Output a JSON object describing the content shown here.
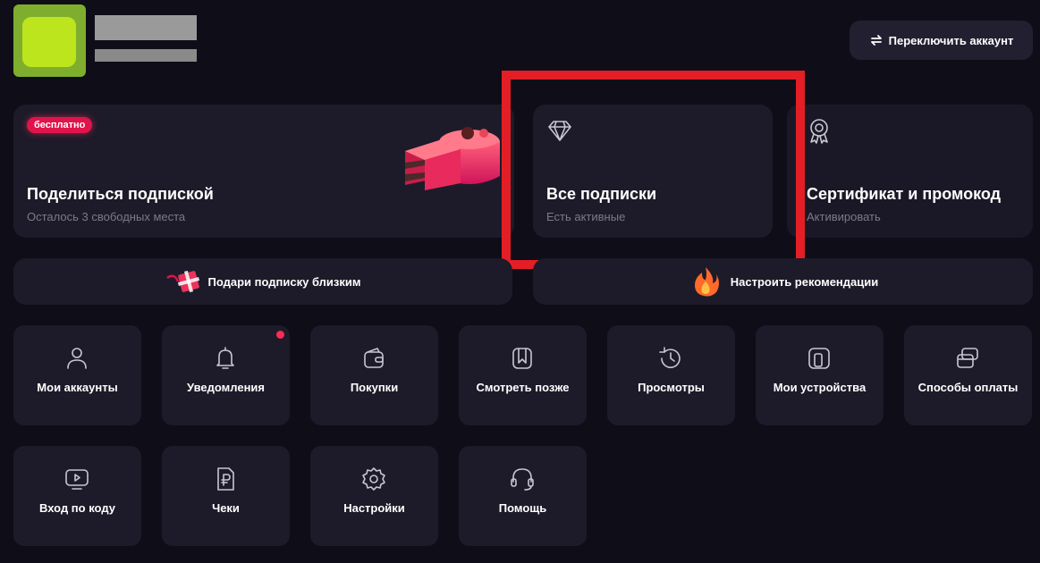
{
  "header": {
    "switch_account": "Переключить аккаунт"
  },
  "share_card": {
    "badge": "бесплатно",
    "title": "Поделиться подпиской",
    "subtitle": "Осталось 3 свободных места"
  },
  "subscriptions_card": {
    "title": "Все подписки",
    "subtitle": "Есть активные"
  },
  "certificate_card": {
    "title": "Сертификат и промокод",
    "subtitle": "Активировать"
  },
  "gift_button": {
    "label": "Подари подписку близким"
  },
  "recommendations_button": {
    "label": "Настроить рекомендации"
  },
  "tiles_row1": [
    {
      "label": "Мои аккаунты",
      "icon": "user-icon"
    },
    {
      "label": "Уведомления",
      "icon": "bell-icon"
    },
    {
      "label": "Покупки",
      "icon": "wallet-icon"
    },
    {
      "label": "Смотреть позже",
      "icon": "bookmark-icon"
    },
    {
      "label": "Просмотры",
      "icon": "history-icon"
    },
    {
      "label": "Мои устройства",
      "icon": "devices-icon"
    },
    {
      "label": "Способы оплаты",
      "icon": "cards-icon"
    }
  ],
  "tiles_row2": [
    {
      "label": "Вход по коду",
      "icon": "tv-play-icon"
    },
    {
      "label": "Чеки",
      "icon": "receipt-icon"
    },
    {
      "label": "Настройки",
      "icon": "gear-icon"
    },
    {
      "label": "Помощь",
      "icon": "headset-icon"
    }
  ],
  "colors": {
    "background": "#0f0d17",
    "card": "#1d1b29",
    "badge": "#e0134a",
    "highlight_frame": "#e41e26",
    "notification_dot": "#ff2a55"
  }
}
